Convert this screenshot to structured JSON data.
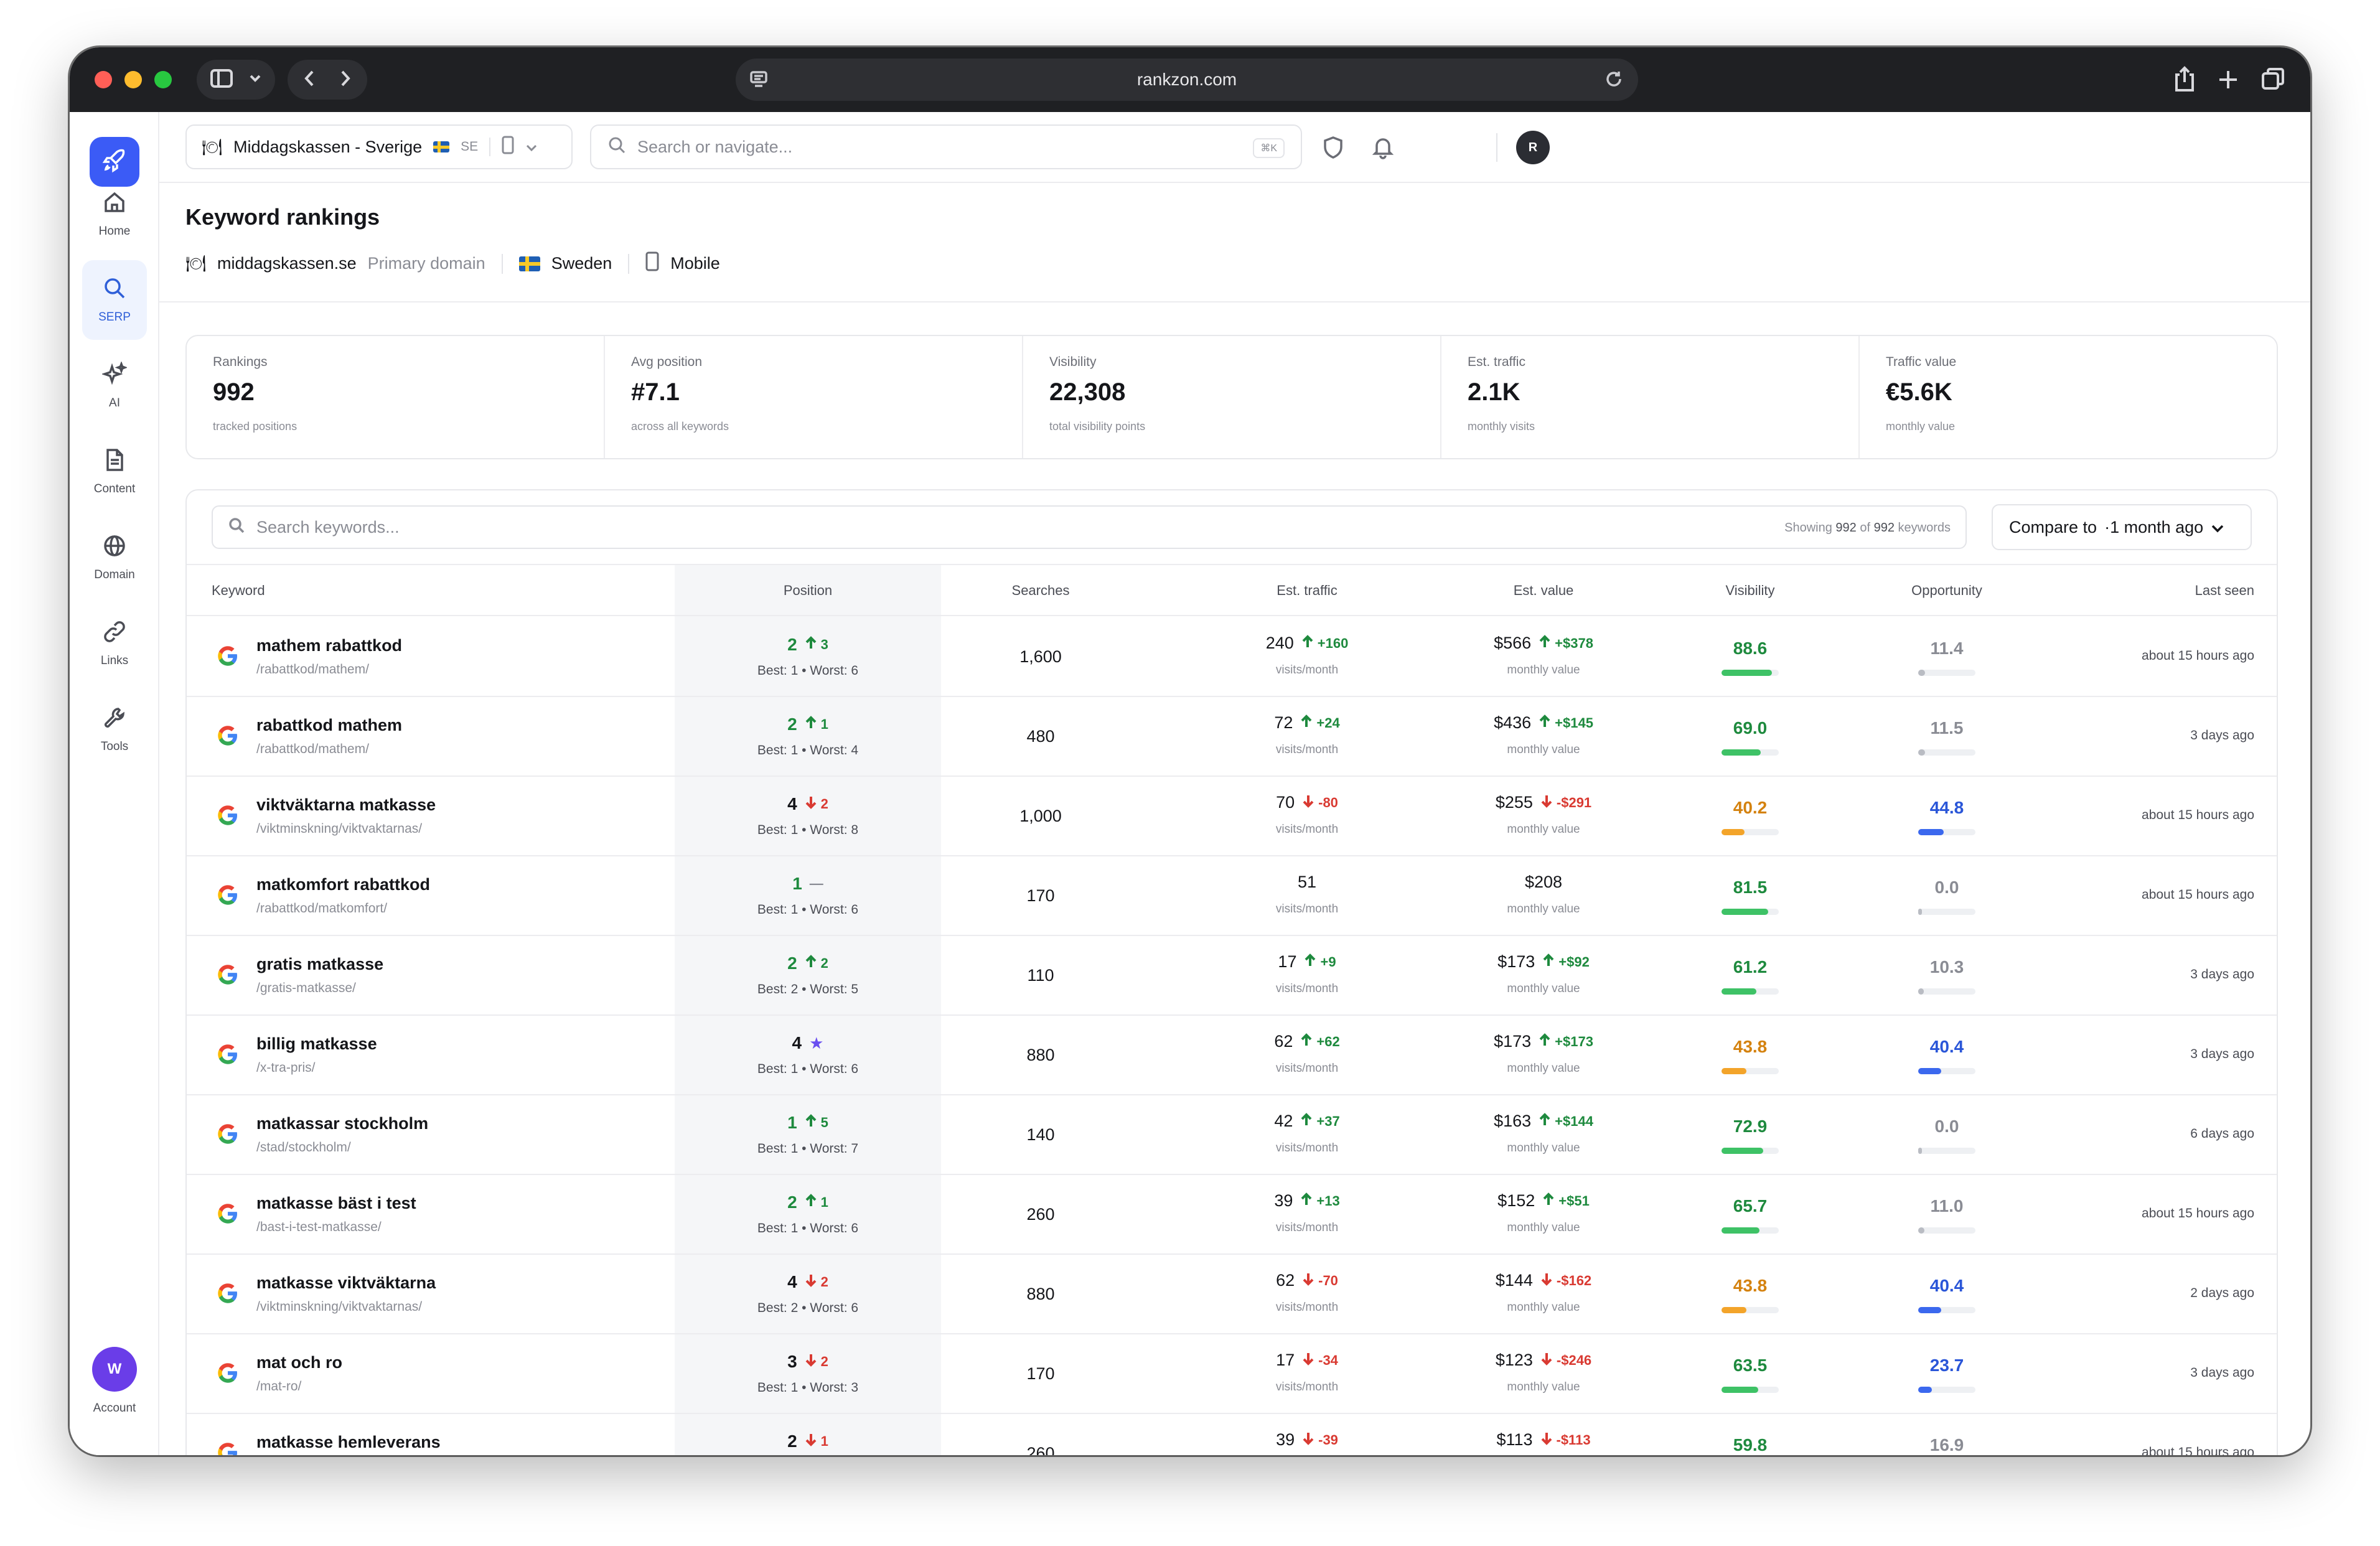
{
  "browser": {
    "url": "rankzon.com"
  },
  "sidebar": {
    "items": [
      {
        "label": "Home",
        "icon": "home-icon"
      },
      {
        "label": "SERP",
        "icon": "search-icon",
        "active": true
      },
      {
        "label": "AI",
        "icon": "sparkles-icon"
      },
      {
        "label": "Content",
        "icon": "document-icon"
      },
      {
        "label": "Domain",
        "icon": "globe-icon"
      },
      {
        "label": "Links",
        "icon": "link-icon"
      },
      {
        "label": "Tools",
        "icon": "wrench-icon"
      }
    ],
    "account": {
      "initial": "W",
      "label": "Account"
    }
  },
  "topbar": {
    "project": "Middagskassen - Sverige",
    "country_code": "SE",
    "search_placeholder": "Search or navigate...",
    "shortcut": "⌘K",
    "user_initial": "R"
  },
  "page": {
    "title": "Keyword rankings",
    "domain": "middagskassen.se",
    "domain_tag": "Primary domain",
    "country": "Sweden",
    "device": "Mobile"
  },
  "stats": [
    {
      "label": "Rankings",
      "value": "992",
      "sub": "tracked positions"
    },
    {
      "label": "Avg position",
      "value": "#7.1",
      "sub": "across all keywords"
    },
    {
      "label": "Visibility",
      "value": "22,308",
      "sub": "total visibility points"
    },
    {
      "label": "Est. traffic",
      "value": "2.1K",
      "sub": "monthly visits"
    },
    {
      "label": "Traffic value",
      "value": "€5.6K",
      "sub": "monthly value"
    }
  ],
  "table": {
    "search_placeholder": "Search keywords...",
    "showing_prefix": "Showing",
    "showing_count": "992",
    "showing_of": "of",
    "showing_total": "992",
    "showing_suffix": "keywords",
    "compare_label": "Compare to",
    "compare_value": "·1 month ago",
    "columns": [
      "Keyword",
      "Position",
      "Searches",
      "Est. traffic",
      "Est. value",
      "Visibility",
      "Opportunity",
      "Last seen"
    ],
    "traffic_unit": "visits/month",
    "value_unit": "monthly value",
    "rows": [
      {
        "keyword": "mathem rabattkod",
        "url": "/rabattkod/mathem/",
        "pos": "2",
        "pos_dir": "up",
        "pos_change": "3",
        "range": "Best: 1 • Worst: 6",
        "searches": "1,600",
        "traffic": "240",
        "traffic_dir": "up",
        "traffic_change": "+160",
        "value": "$566",
        "value_dir": "up",
        "value_change": "+$378",
        "visibility": "88.6",
        "vis_pct": 0.88,
        "vis_color": "green",
        "opportunity": "11.4",
        "opp_pct": 0.12,
        "opp_color": "grey",
        "last_seen": "about 15 hours ago"
      },
      {
        "keyword": "rabattkod mathem",
        "url": "/rabattkod/mathem/",
        "pos": "2",
        "pos_dir": "up",
        "pos_change": "1",
        "range": "Best: 1 • Worst: 4",
        "searches": "480",
        "traffic": "72",
        "traffic_dir": "up",
        "traffic_change": "+24",
        "value": "$436",
        "value_dir": "up",
        "value_change": "+$145",
        "visibility": "69.0",
        "vis_pct": 0.69,
        "vis_color": "green",
        "opportunity": "11.5",
        "opp_pct": 0.12,
        "opp_color": "grey",
        "last_seen": "3 days ago"
      },
      {
        "keyword": "viktväktarna matkasse",
        "url": "/viktminskning/viktvaktarnas/",
        "pos": "4",
        "pos_dir": "down",
        "pos_change": "2",
        "range": "Best: 1 • Worst: 8",
        "searches": "1,000",
        "traffic": "70",
        "traffic_dir": "down",
        "traffic_change": "-80",
        "value": "$255",
        "value_dir": "down",
        "value_change": "-$291",
        "visibility": "40.2",
        "vis_pct": 0.4,
        "vis_color": "orange",
        "opportunity": "44.8",
        "opp_pct": 0.45,
        "opp_color": "blue",
        "last_seen": "about 15 hours ago"
      },
      {
        "keyword": "matkomfort rabattkod",
        "url": "/rabattkod/matkomfort/",
        "pos": "1",
        "pos_dir": "flat",
        "pos_change": "—",
        "range": "Best: 1 • Worst: 6",
        "searches": "170",
        "traffic": "51",
        "traffic_dir": "none",
        "traffic_change": "",
        "value": "$208",
        "value_dir": "none",
        "value_change": "",
        "visibility": "81.5",
        "vis_pct": 0.82,
        "vis_color": "green",
        "opportunity": "0.0",
        "opp_pct": 0.0,
        "opp_color": "grey",
        "last_seen": "about 15 hours ago"
      },
      {
        "keyword": "gratis matkasse",
        "url": "/gratis-matkasse/",
        "pos": "2",
        "pos_dir": "up",
        "pos_change": "2",
        "range": "Best: 2 • Worst: 5",
        "searches": "110",
        "traffic": "17",
        "traffic_dir": "up",
        "traffic_change": "+9",
        "value": "$173",
        "value_dir": "up",
        "value_change": "+$92",
        "visibility": "61.2",
        "vis_pct": 0.61,
        "vis_color": "green",
        "opportunity": "10.3",
        "opp_pct": 0.1,
        "opp_color": "grey",
        "last_seen": "3 days ago"
      },
      {
        "keyword": "billig matkasse",
        "url": "/x-tra-pris/",
        "pos": "4",
        "pos_dir": "new",
        "pos_change": "★",
        "range": "Best: 1 • Worst: 6",
        "searches": "880",
        "traffic": "62",
        "traffic_dir": "up",
        "traffic_change": "+62",
        "value": "$173",
        "value_dir": "up",
        "value_change": "+$173",
        "visibility": "43.8",
        "vis_pct": 0.44,
        "vis_color": "orange",
        "opportunity": "40.4",
        "opp_pct": 0.4,
        "opp_color": "blue",
        "last_seen": "3 days ago"
      },
      {
        "keyword": "matkassar stockholm",
        "url": "/stad/stockholm/",
        "pos": "1",
        "pos_dir": "up",
        "pos_change": "5",
        "range": "Best: 1 • Worst: 7",
        "searches": "140",
        "traffic": "42",
        "traffic_dir": "up",
        "traffic_change": "+37",
        "value": "$163",
        "value_dir": "up",
        "value_change": "+$144",
        "visibility": "72.9",
        "vis_pct": 0.73,
        "vis_color": "green",
        "opportunity": "0.0",
        "opp_pct": 0.0,
        "opp_color": "grey",
        "last_seen": "6 days ago"
      },
      {
        "keyword": "matkasse bäst i test",
        "url": "/bast-i-test-matkasse/",
        "pos": "2",
        "pos_dir": "up",
        "pos_change": "1",
        "range": "Best: 1 • Worst: 6",
        "searches": "260",
        "traffic": "39",
        "traffic_dir": "up",
        "traffic_change": "+13",
        "value": "$152",
        "value_dir": "up",
        "value_change": "+$51",
        "visibility": "65.7",
        "vis_pct": 0.66,
        "vis_color": "green",
        "opportunity": "11.0",
        "opp_pct": 0.11,
        "opp_color": "grey",
        "last_seen": "about 15 hours ago"
      },
      {
        "keyword": "matkasse viktväktarna",
        "url": "/viktminskning/viktvaktarnas/",
        "pos": "4",
        "pos_dir": "down",
        "pos_change": "2",
        "range": "Best: 2 • Worst: 6",
        "searches": "880",
        "traffic": "62",
        "traffic_dir": "down",
        "traffic_change": "-70",
        "value": "$144",
        "value_dir": "down",
        "value_change": "-$162",
        "visibility": "43.8",
        "vis_pct": 0.44,
        "vis_color": "orange",
        "opportunity": "40.4",
        "opp_pct": 0.4,
        "opp_color": "blue",
        "last_seen": "2 days ago"
      },
      {
        "keyword": "mat och ro",
        "url": "/mat-ro/",
        "pos": "3",
        "pos_dir": "down",
        "pos_change": "2",
        "range": "Best: 1 • Worst: 3",
        "searches": "170",
        "traffic": "17",
        "traffic_dir": "down",
        "traffic_change": "-34",
        "value": "$123",
        "value_dir": "down",
        "value_change": "-$246",
        "visibility": "63.5",
        "vis_pct": 0.64,
        "vis_color": "green",
        "opportunity": "23.7",
        "opp_pct": 0.24,
        "opp_color": "blue",
        "last_seen": "3 days ago"
      },
      {
        "keyword": "matkasse hemleverans",
        "url": "",
        "pos": "2",
        "pos_dir": "down",
        "pos_change": "1",
        "range": "",
        "searches": "260",
        "traffic": "39",
        "traffic_dir": "down",
        "traffic_change": "-39",
        "value": "$113",
        "value_dir": "down",
        "value_change": "-$113",
        "visibility": "59.8",
        "vis_pct": 0.6,
        "vis_color": "green",
        "opportunity": "16.9",
        "opp_pct": 0.17,
        "opp_color": "grey",
        "last_seen": "about 15 hours ago"
      }
    ]
  }
}
